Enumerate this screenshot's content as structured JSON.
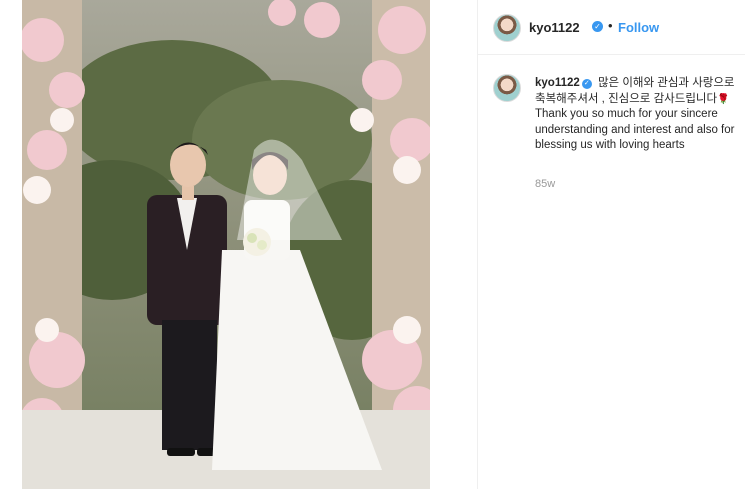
{
  "post": {
    "username": "kyo1122",
    "follow_label": "Follow",
    "separator": "•",
    "verified_icon": "verified-badge-icon",
    "accent_color": "#3897f0",
    "caption": {
      "username": "kyo1122",
      "text_korean": "많은 이해와 관심과 사랑으로 축복해주셔서 , 진심으로 감사드립니다",
      "emoji": "rose-icon",
      "text_english": "Thank you so much for your sincere understanding and interest and also for blessing us with loving hearts"
    },
    "timestamp": "85w"
  }
}
